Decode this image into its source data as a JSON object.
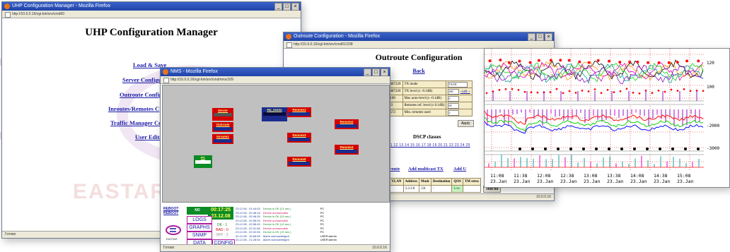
{
  "window1": {
    "title": "UHP Configuration Manager - Mozilla Firefox",
    "url": "http://10.0.0.16/cgi-bin/srv/cmd60",
    "page_title": "UHP Configuration Manager",
    "links": [
      "Load & Save",
      "Server Configuration",
      "Outroute Configuration",
      "Inroutes/Remotes Configuration",
      "Traffic Manager Configuration",
      "User Editor"
    ],
    "links_visible": [
      "Load & Save",
      "Server Configu",
      "Outroute Config",
      "Inroutes/Remotes C",
      "Traffic Manager Co",
      "User Edito"
    ],
    "status": "Готово",
    "watermark": "EASTAR"
  },
  "window2": {
    "title": "Outroute Configuration - Mozilla Firefox",
    "url": "http://10.0.0.16/cgi-bin/srv/cmd01/238",
    "page_title": "Outroute Configuration",
    "back_link": "Back",
    "rows": [
      {
        "left": "1487220",
        "label": "TX mode",
        "value": "TXON",
        "extra": ""
      },
      {
        "left": "1487220",
        "label": "TX level (x -0.1dB)",
        "value": "260",
        "extra": "-1dB +"
      },
      {
        "left": "1100",
        "label": "Max auto-level (x -0.1dB)",
        "value": "0",
        "extra": ""
      },
      {
        "left": "1/2",
        "label": "Remotes ref. level (x 0.1dB)",
        "value": "60",
        "extra": ""
      },
      {
        "left": "2572",
        "label": "Min. remotes used",
        "value": "2",
        "extra": ""
      }
    ],
    "apply_label": "Apply",
    "dscp_title": "DSCP classes",
    "dscp_numbers": "11 12 13 14 15 16 17 18 19 20 21 22 23 24 25",
    "link_static": "tatic IP route",
    "link_multicast": "Add multicast TX",
    "link_add": "Add U",
    "vlan_headers": [
      "c VLAN",
      "Address",
      "Mask",
      "Destination",
      "QOS",
      "TM strea"
    ],
    "vlan_row": [
      "",
      "3.3.3.0",
      "/24",
      "-",
      "Low",
      ""
    ],
    "test_button": "Test no",
    "status": "10.0.0.16"
  },
  "chart": {
    "x_ticks": [
      [
        "11:08",
        "23.Jan"
      ],
      [
        "11:38",
        "23.Jan"
      ],
      [
        "12:08",
        "23.Jan"
      ],
      [
        "12:38",
        "23.Jan"
      ],
      [
        "13:08",
        "23.Jan"
      ],
      [
        "13:38",
        "23.Jan"
      ],
      [
        "14:08",
        "23.Jan"
      ],
      [
        "14:38",
        "23.Jan"
      ],
      [
        "15:08",
        "23.Jan"
      ]
    ],
    "y_labels_top": [
      "120",
      "100"
    ],
    "y_labels_bottom": [
      "-2000",
      "-3000"
    ],
    "colors": {
      "grid": "#d01010",
      "black": "#000000",
      "orange": "#ff9a1a",
      "magenta": "#e000c0",
      "green": "#10d010",
      "red": "#ff1010",
      "blue": "#1010ff",
      "teal": "#10a0a0",
      "purple": "#9010c0"
    }
  },
  "window3": {
    "title": "NMS - Mozilla Firefox",
    "url": "http://10.0.0.16/cgi-bin/srv/cmd/nms/109",
    "nodes": [
      {
        "name": "Server",
        "color": "#d40000"
      },
      {
        "name": "Outroute",
        "color": "#d40000"
      },
      {
        "name": "Inroute1",
        "color": "#d40000"
      },
      {
        "name": "Hu_sssss",
        "color": "#1b2c8c"
      },
      {
        "name": "Remote1",
        "color": "#d40000"
      },
      {
        "name": "Remote2",
        "color": "#d40000"
      },
      {
        "name": "Remote3",
        "color": "#d40000"
      },
      {
        "name": "Remote4",
        "color": "#d40000"
      },
      {
        "name": "Remote5",
        "color": "#d40000"
      },
      {
        "name": "PC",
        "color": "#0c8a26"
      }
    ],
    "reboot_labels": [
      "REBOOT",
      "REBOOT"
    ],
    "no_alarms": "NO ALARMS",
    "time": "00:17:25",
    "date": "23.12.08",
    "buttons": [
      "LOGS",
      "GRAPHS",
      "SNMP",
      "DATA",
      "CONFIG"
    ],
    "statuses": [
      "OK - 1",
      "BAD - 0",
      "OFF - 2"
    ],
    "log": [
      {
        "t": "23.12.08 - 01:44:53",
        "s": "Device is OK (21 sec.)",
        "d": "PC",
        "c": "ok"
      },
      {
        "t": "23.12.08 - 02:48:18",
        "s": "Device unreachable",
        "d": "PC",
        "c": "bad"
      },
      {
        "t": "23.12.08 - 02:46:39",
        "s": "Device is OK (29 sec.)",
        "d": "PC",
        "c": "ok"
      },
      {
        "t": "23.12.08 - 02:58:33",
        "s": "Device unreachable",
        "d": "PC",
        "c": "bad"
      },
      {
        "t": "23.12.08 - 02:58:43",
        "s": "Device is OK (10 sec.)",
        "d": "PC",
        "c": "ok"
      },
      {
        "t": "23.12.08 - 02:31:56",
        "s": "Device unreachable",
        "d": "PC",
        "c": "bad"
      },
      {
        "t": "23.12.08 - 02:32:06",
        "s": "Device is OK (10 sec.)",
        "d": "PC",
        "c": "ok"
      },
      {
        "t": "24.12.08 - 16:58:06",
        "s": "Alarm acknowledged",
        "d": "USER:admin",
        "c": "bl"
      },
      {
        "t": "24.12.08 - 21:28:54",
        "s": "Alarm acknowledged",
        "d": "USER:admin",
        "c": "bl"
      }
    ],
    "logo_text": "EASTAR",
    "status_left": "Готово",
    "status_right": "10.0.0.16"
  }
}
